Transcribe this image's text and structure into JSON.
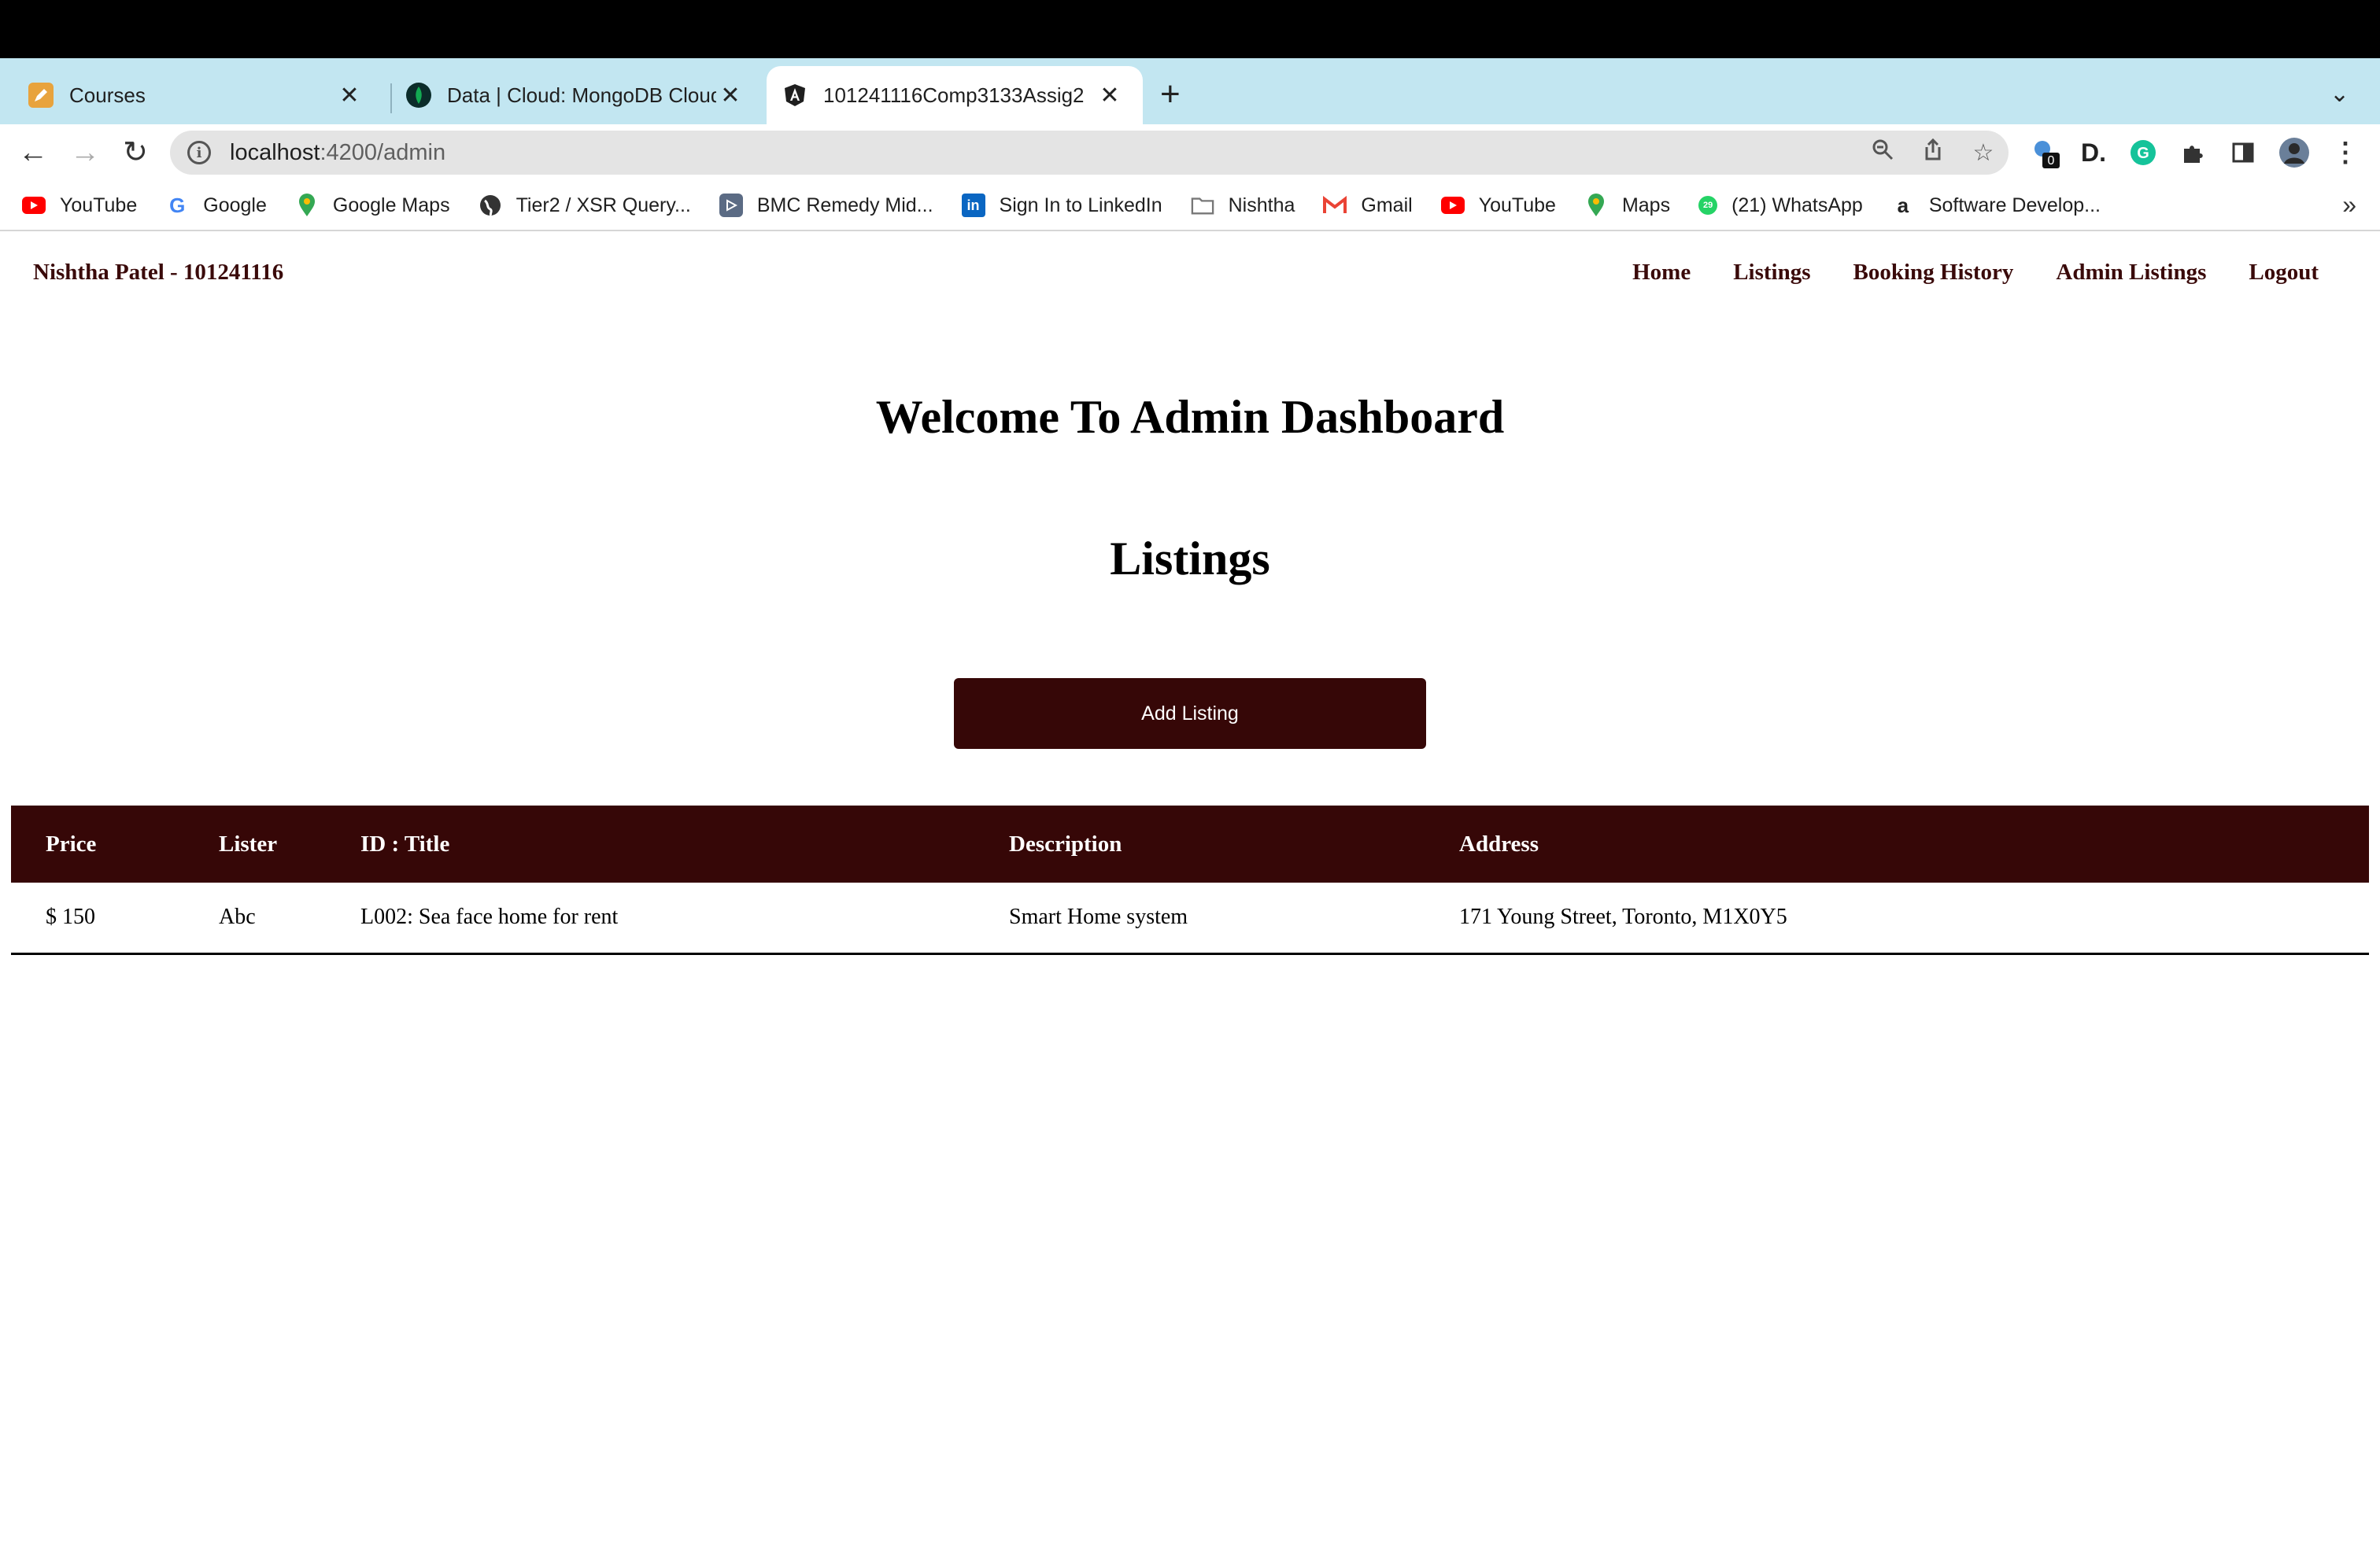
{
  "browser": {
    "tabs": [
      {
        "title": "Courses",
        "favicon": "courses-icon",
        "color": "#e8a33d"
      },
      {
        "title": "Data | Cloud: MongoDB Cloud",
        "favicon": "mongodb-icon",
        "color": "#13aa52"
      },
      {
        "title": "101241116Comp3133Assig2",
        "favicon": "angular-icon",
        "color": "#1f1f1f"
      }
    ],
    "url_host": "localhost",
    "url_path": ":4200/admin",
    "extension_badge": "0",
    "bookmarks": [
      {
        "label": "YouTube",
        "icon": "youtube-icon",
        "color": "#ff0000"
      },
      {
        "label": "Google",
        "icon": "google-icon",
        "color": "#4285f4"
      },
      {
        "label": "Google Maps",
        "icon": "maps-pin-icon",
        "color": "#34a853"
      },
      {
        "label": "Tier2 / XSR Query...",
        "icon": "globe-icon",
        "color": "#333333"
      },
      {
        "label": "BMC Remedy Mid...",
        "icon": "bmc-icon",
        "color": "#5b6b84"
      },
      {
        "label": "Sign In to LinkedIn",
        "icon": "linkedin-icon",
        "color": "#0a66c2"
      },
      {
        "label": "Nishtha",
        "icon": "folder-icon",
        "color": "#8a8a8a"
      },
      {
        "label": "Gmail",
        "icon": "gmail-icon",
        "color": "#ea4335"
      },
      {
        "label": "YouTube",
        "icon": "youtube-icon",
        "color": "#ff0000"
      },
      {
        "label": "Maps",
        "icon": "maps-pin-icon",
        "color": "#34a853"
      },
      {
        "label": "(21) WhatsApp",
        "icon": "whatsapp-icon",
        "color": "#25d366"
      },
      {
        "label": "Software Develop...",
        "icon": "amazon-icon",
        "color": "#222222"
      }
    ]
  },
  "site": {
    "brand": "Nishtha Patel - 101241116",
    "nav": [
      "Home",
      "Listings",
      "Booking History",
      "Admin Listings",
      "Logout"
    ],
    "welcome": "Welcome To Admin Dashboard",
    "section_title": "Listings",
    "add_button": "Add Listing",
    "accent": "#360707",
    "table": {
      "headers": [
        "Price",
        "Lister",
        "ID : Title",
        "Description",
        "Address"
      ],
      "rows": [
        [
          "$ 150",
          "Abc",
          "L002: Sea face home for rent",
          "Smart Home system",
          "171 Young Street, Toronto, M1X0Y5"
        ]
      ]
    }
  }
}
